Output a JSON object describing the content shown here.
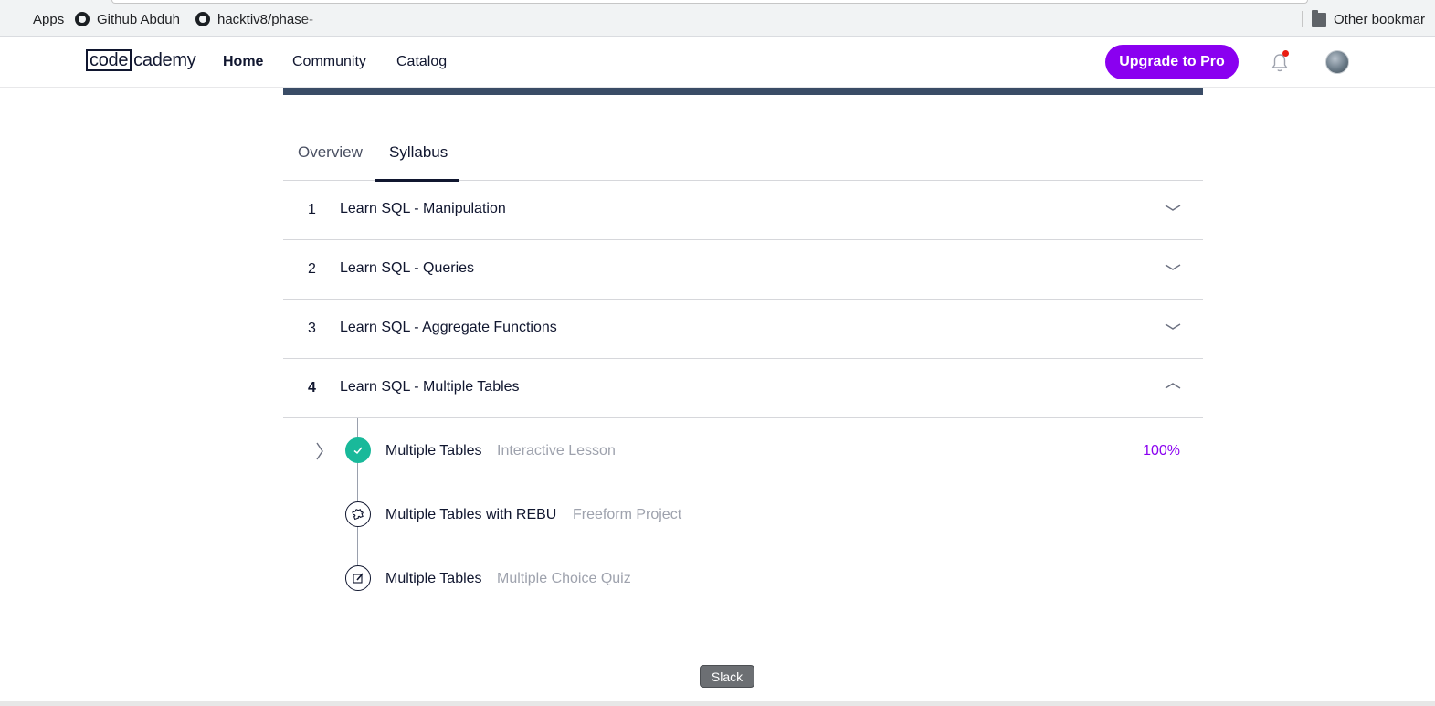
{
  "browser": {
    "bookmarks": [
      {
        "label": "Apps",
        "icon": "apps-grid-icon"
      },
      {
        "label": "Github Abduh",
        "icon": "github-icon"
      },
      {
        "label": "hacktiv8/phase-",
        "icon": "github-icon"
      }
    ],
    "other_bookmarks": "Other bookmar"
  },
  "navbar": {
    "logo_box": "code",
    "logo_rest": "cademy",
    "links": [
      "Home",
      "Community",
      "Catalog"
    ],
    "active_link": "Home",
    "upgrade_label": "Upgrade to Pro",
    "notification_badge": true
  },
  "tabs": [
    {
      "label": "Overview",
      "active": false
    },
    {
      "label": "Syllabus",
      "active": true
    }
  ],
  "syllabus": [
    {
      "num": "1",
      "title": "Learn SQL - Manipulation",
      "expanded": false
    },
    {
      "num": "2",
      "title": "Learn SQL - Queries",
      "expanded": false
    },
    {
      "num": "3",
      "title": "Learn SQL - Aggregate Functions",
      "expanded": false
    },
    {
      "num": "4",
      "title": "Learn SQL - Multiple Tables",
      "expanded": true
    }
  ],
  "lessons": [
    {
      "name": "Multiple Tables",
      "type": "Interactive Lesson",
      "progress": "100%",
      "icon": "check-icon",
      "completed": true
    },
    {
      "name": "Multiple Tables with REBU",
      "type": "Freeform Project",
      "progress": "",
      "icon": "puzzle-icon",
      "completed": false
    },
    {
      "name": "Multiple Tables",
      "type": "Multiple Choice Quiz",
      "progress": "",
      "icon": "quiz-edit-icon",
      "completed": false
    }
  ],
  "tooltip": "Slack",
  "colors": {
    "brand_purple": "#8a00f0",
    "navy": "#10162f",
    "complete_green": "#19b99a",
    "muted_text": "#9ea2ad"
  }
}
